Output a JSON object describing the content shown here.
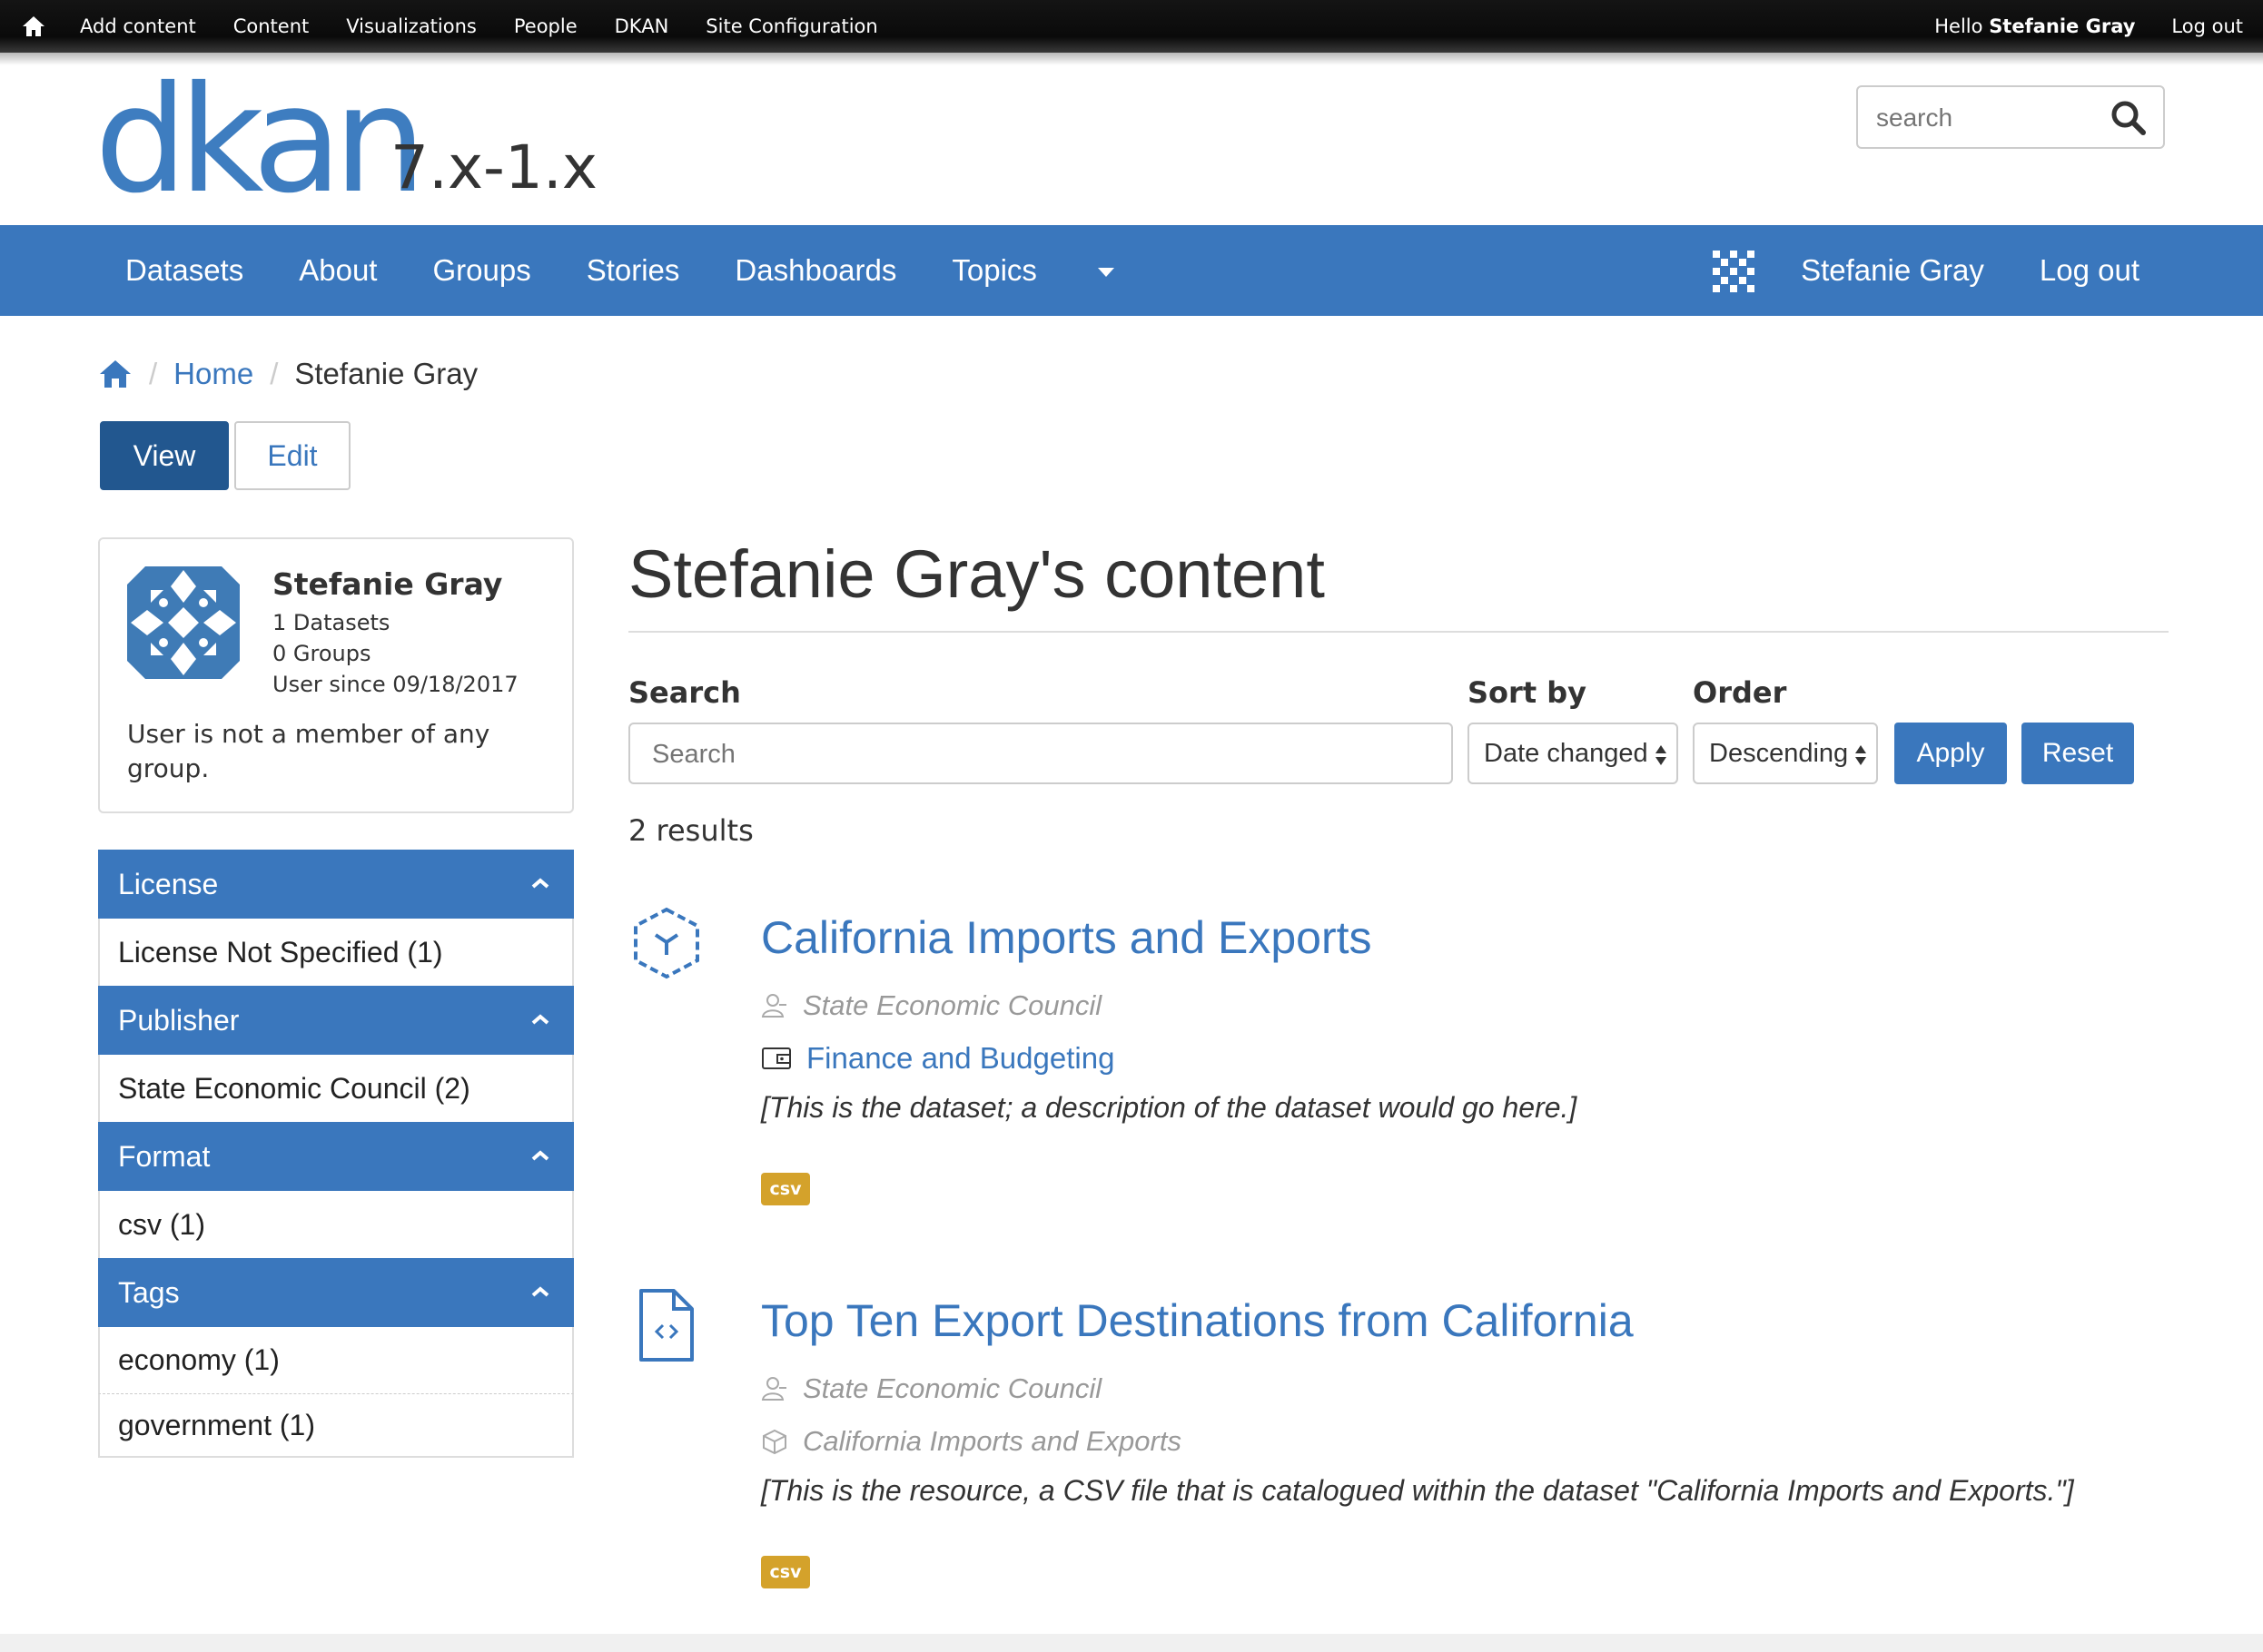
{
  "admin_bar": {
    "items": [
      "Add content",
      "Content",
      "Visualizations",
      "People",
      "DKAN",
      "Site Configuration"
    ],
    "greeting": "Hello",
    "user_name": "Stefanie Gray",
    "logout": "Log out"
  },
  "branding": {
    "logo_text": "dkan",
    "version": "7.x-1.x",
    "search_placeholder": "search"
  },
  "main_nav": {
    "items": [
      "Datasets",
      "About",
      "Groups",
      "Stories",
      "Dashboards",
      "Topics"
    ],
    "user_name": "Stefanie Gray",
    "logout": "Log out"
  },
  "breadcrumb": {
    "home": "Home",
    "current": "Stefanie Gray"
  },
  "tabs": {
    "view": "View",
    "edit": "Edit"
  },
  "profile": {
    "name": "Stefanie Gray",
    "datasets": "1 Datasets",
    "groups": "0 Groups",
    "since": "User since 09/18/2017",
    "note": "User is not a member of any group."
  },
  "facets": [
    {
      "title": "License",
      "items": [
        "License Not Specified (1)"
      ]
    },
    {
      "title": "Publisher",
      "items": [
        "State Economic Council (2)"
      ]
    },
    {
      "title": "Format",
      "items": [
        "csv (1)"
      ]
    },
    {
      "title": "Tags",
      "items": [
        "economy (1)",
        "government (1)"
      ]
    }
  ],
  "content": {
    "title": "Stefanie Gray's content",
    "search_label": "Search",
    "search_placeholder": "Search",
    "sort_label": "Sort by",
    "sort_value": "Date changed",
    "order_label": "Order",
    "order_value": "Descending",
    "apply": "Apply",
    "reset": "Reset",
    "results_count": "2 results"
  },
  "results": [
    {
      "title": "California Imports and Exports",
      "publisher": "State Economic Council",
      "topic": "Finance and Budgeting",
      "description": "[This is the dataset; a description of the dataset would go here.]",
      "format": "csv",
      "icon": "dataset-cube-icon"
    },
    {
      "title": "Top Ten Export Destinations from California",
      "publisher": "State Economic Council",
      "parent_dataset": "California Imports and Exports",
      "description": "[This is the resource, a CSV file that is catalogued within the dataset \"California Imports and Exports.\"]",
      "format": "csv",
      "icon": "resource-file-code-icon"
    }
  ],
  "colors": {
    "brand_blue": "#3a77bd",
    "active_tab": "#22578f",
    "csv_badge": "#d4a22b",
    "admin_bar": "#111111"
  }
}
